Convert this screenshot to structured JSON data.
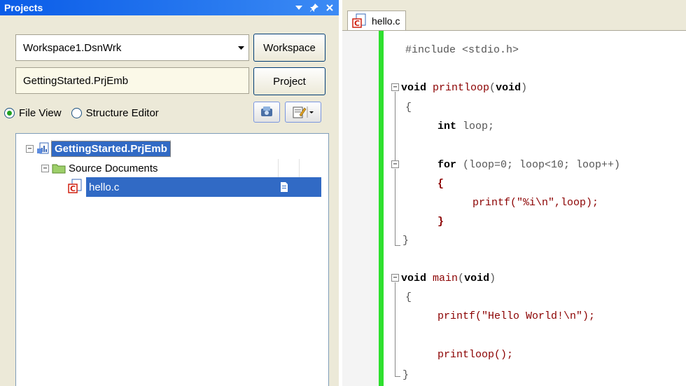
{
  "panel": {
    "title": "Projects",
    "workspace_combo": "Workspace1.DsnWrk",
    "workspace_button": "Workspace",
    "project_field": "GettingStarted.PrjEmb",
    "project_button": "Project",
    "radio_file_view": "File View",
    "radio_structure_editor": "Structure Editor"
  },
  "tree": {
    "root": "GettingStarted.PrjEmb",
    "folder": "Source Documents",
    "file": "hello.c"
  },
  "editor": {
    "tab": "hello.c",
    "code": {
      "l1": "#include <stdio.h>",
      "l2_kw1": "void",
      "l2_id": "printloop",
      "l2_p1": "(",
      "l2_kw2": "void",
      "l2_p2": ")",
      "l3": "{",
      "l4_kw": "int",
      "l4_rest": " loop;",
      "l5_kw": "for",
      "l5_rest": " (loop=0; loop<10; loop++)",
      "l6": "{",
      "l7": "printf(\"%i\\n\",loop);",
      "l8": "}",
      "l9": "}",
      "l10_kw1": "void",
      "l10_id": "main",
      "l10_p1": "(",
      "l10_kw2": "void",
      "l10_p2": ")",
      "l11": "{",
      "l12": "printf(\"Hello World!\\n\");",
      "l13": "printloop();",
      "l14": "}"
    }
  },
  "colors": {
    "titlebar": "#0a5ce8",
    "selection": "#316ac5",
    "change_bar": "#2ee02e"
  }
}
